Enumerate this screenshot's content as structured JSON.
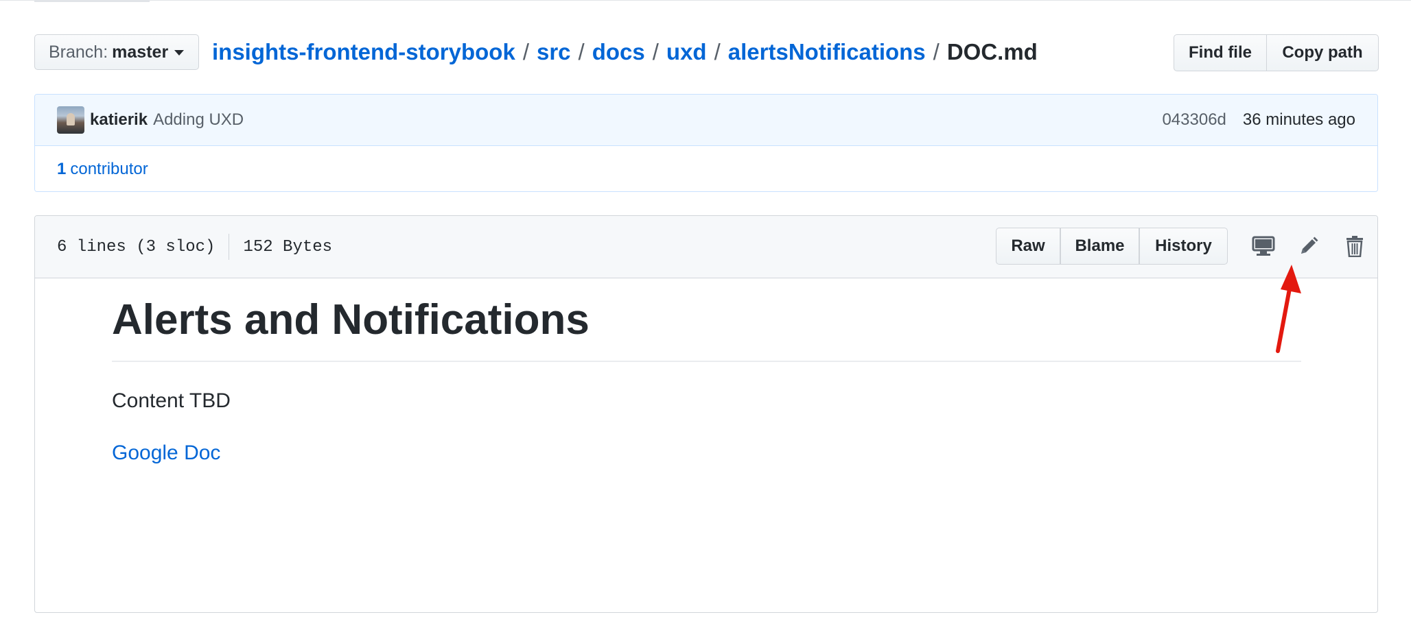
{
  "branch": {
    "label": "Branch:",
    "name": "master"
  },
  "breadcrumb": {
    "segments": [
      "insights-frontend-storybook",
      "src",
      "docs",
      "uxd",
      "alertsNotifications"
    ],
    "separator": "/",
    "file": "DOC.md"
  },
  "file_actions": {
    "find_file": "Find file",
    "copy_path": "Copy path"
  },
  "commit": {
    "author": "katierik",
    "message": "Adding UXD",
    "sha": "043306d",
    "time": "36 minutes ago"
  },
  "contributors": {
    "count": "1",
    "label": "contributor"
  },
  "file": {
    "lines": "6 lines (3 sloc)",
    "size": "152 Bytes",
    "buttons": {
      "raw": "Raw",
      "blame": "Blame",
      "history": "History"
    },
    "icons": [
      "desktop-icon",
      "pencil-icon",
      "trash-icon"
    ]
  },
  "markdown": {
    "heading": "Alerts and Notifications",
    "paragraph": "Content TBD",
    "link": "Google Doc"
  },
  "colors": {
    "link": "#0366d6",
    "annotation_arrow": "#e3190f"
  }
}
